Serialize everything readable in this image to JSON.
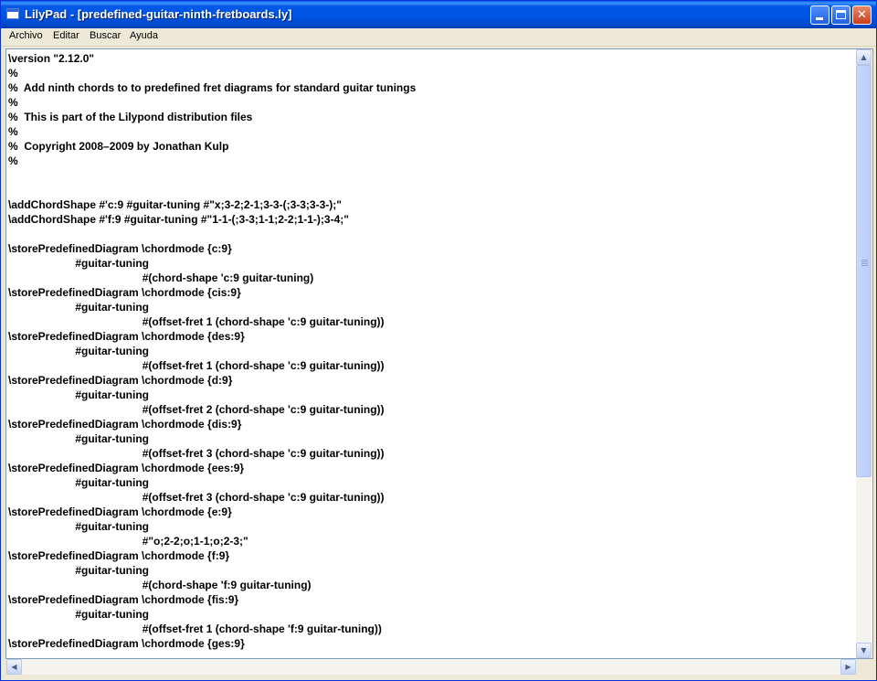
{
  "window": {
    "title": "LilyPad - [predefined-guitar-ninth-fretboards.ly]",
    "buttons": {
      "minimize": "",
      "maximize": "",
      "close": "✕"
    }
  },
  "menubar": {
    "items": [
      "Archivo",
      "Editar",
      "Buscar",
      "Ayuda"
    ]
  },
  "editor": {
    "lines": [
      "\\version \"2.12.0\"",
      "%",
      "%  Add ninth chords to to predefined fret diagrams for standard guitar tunings",
      "%",
      "%  This is part of the Lilypond distribution files",
      "%",
      "%  Copyright 2008–2009 by Jonathan Kulp",
      "%",
      "",
      "",
      "\\addChordShape #'c:9 #guitar-tuning #\"x;3-2;2-1;3-3-(;3-3;3-3-);\"",
      "\\addChordShape #'f:9 #guitar-tuning #\"1-1-(;3-3;1-1;2-2;1-1-);3-4;\"",
      "",
      "\\storePredefinedDiagram \\chordmode {c:9}",
      "                      #guitar-tuning",
      "                                            #(chord-shape 'c:9 guitar-tuning)",
      "\\storePredefinedDiagram \\chordmode {cis:9}",
      "                      #guitar-tuning",
      "                                            #(offset-fret 1 (chord-shape 'c:9 guitar-tuning))",
      "\\storePredefinedDiagram \\chordmode {des:9}",
      "                      #guitar-tuning",
      "                                            #(offset-fret 1 (chord-shape 'c:9 guitar-tuning))",
      "\\storePredefinedDiagram \\chordmode {d:9}",
      "                      #guitar-tuning",
      "                                            #(offset-fret 2 (chord-shape 'c:9 guitar-tuning))",
      "\\storePredefinedDiagram \\chordmode {dis:9}",
      "                      #guitar-tuning",
      "                                            #(offset-fret 3 (chord-shape 'c:9 guitar-tuning))",
      "\\storePredefinedDiagram \\chordmode {ees:9}",
      "                      #guitar-tuning",
      "                                            #(offset-fret 3 (chord-shape 'c:9 guitar-tuning))",
      "\\storePredefinedDiagram \\chordmode {e:9}",
      "                      #guitar-tuning",
      "                                            #\"o;2-2;o;1-1;o;2-3;\"",
      "\\storePredefinedDiagram \\chordmode {f:9}",
      "                      #guitar-tuning",
      "                                            #(chord-shape 'f:9 guitar-tuning)",
      "\\storePredefinedDiagram \\chordmode {fis:9}",
      "                      #guitar-tuning",
      "                                            #(offset-fret 1 (chord-shape 'f:9 guitar-tuning))",
      "\\storePredefinedDiagram \\chordmode {ges:9}"
    ]
  },
  "scrollbars": {
    "up": "▲",
    "down": "▼",
    "left": "◀",
    "right": "▶"
  }
}
